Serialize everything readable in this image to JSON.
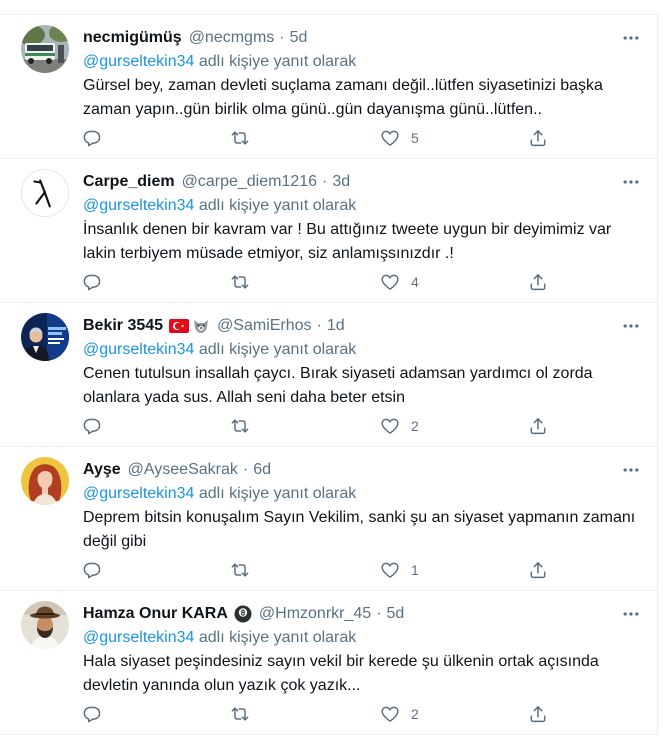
{
  "ui": {
    "separator": "·",
    "colors": {
      "text": "#0f1419",
      "secondary": "#5b7083",
      "link": "#1b95e0",
      "border": "#ebeef0",
      "background": "#ffffff"
    },
    "icons": {
      "more": "more-icon",
      "reply": "reply-icon",
      "retweet": "retweet-icon",
      "like": "like-icon",
      "share": "share-icon"
    }
  },
  "tweets": [
    {
      "name": "necmigümüş",
      "handle": "@necmgms",
      "time": "5d",
      "reply_to": "@gurseltekin34",
      "reply_suffix": "adlı kişiye yanıt olarak",
      "text_lines": [
        "Gürsel bey, zaman devleti suçlama zamanı değil..lütfen siyasetinizi başka",
        "zaman yapın..gün birlik olma günü..gün dayanışma günü..lütfen.."
      ],
      "like_count": "5"
    },
    {
      "name": "Carpe_diem",
      "handle": "@carpe_diem1216",
      "time": "3d",
      "reply_to": "@gurseltekin34",
      "reply_suffix": "adlı kişiye yanıt olarak",
      "text_lines": [
        "İnsanlık denen bir kavram var ! Bu attığınız tweete uygun bir deyimimiz var",
        "lakin terbiyem müsade etmiyor, siz anlamışsınızdır .!"
      ],
      "like_count": "4"
    },
    {
      "name": "Bekir 3545",
      "name_badges": [
        "turkey-flag-icon",
        "wolf-icon"
      ],
      "handle": "@SamiErhos",
      "time": "1d",
      "reply_to": "@gurseltekin34",
      "reply_suffix": "adlı kişiye yanıt olarak",
      "text_lines": [
        "Cenen tutulsun insallah çaycı. Bırak siyaseti adamsan yardımcı ol zorda",
        "olanlara yada sus. Allah seni daha beter etsin"
      ],
      "like_count": "2"
    },
    {
      "name": "Ayşe",
      "handle": "@AyseeSakrak",
      "time": "6d",
      "reply_to": "@gurseltekin34",
      "reply_suffix": "adlı kişiye yanıt olarak",
      "text_lines": [
        "Deprem bitsin konuşalım Sayın Vekilim, sanki şu an siyaset yapmanın zamanı",
        "değil gibi"
      ],
      "like_count": "1"
    },
    {
      "name": "Hamza Onur KARA",
      "name_badges": [
        "8-ball-icon"
      ],
      "handle": "@Hmzonrkr_45",
      "time": "5d",
      "reply_to": "@gurseltekin34",
      "reply_suffix": "adlı kişiye yanıt olarak",
      "text_lines": [
        "Hala siyaset peşindesiniz sayın vekil bir kerede şu ülkenin ortak açısında",
        "devletin yanında olun yazık çok yazık..."
      ],
      "like_count": "2"
    }
  ]
}
